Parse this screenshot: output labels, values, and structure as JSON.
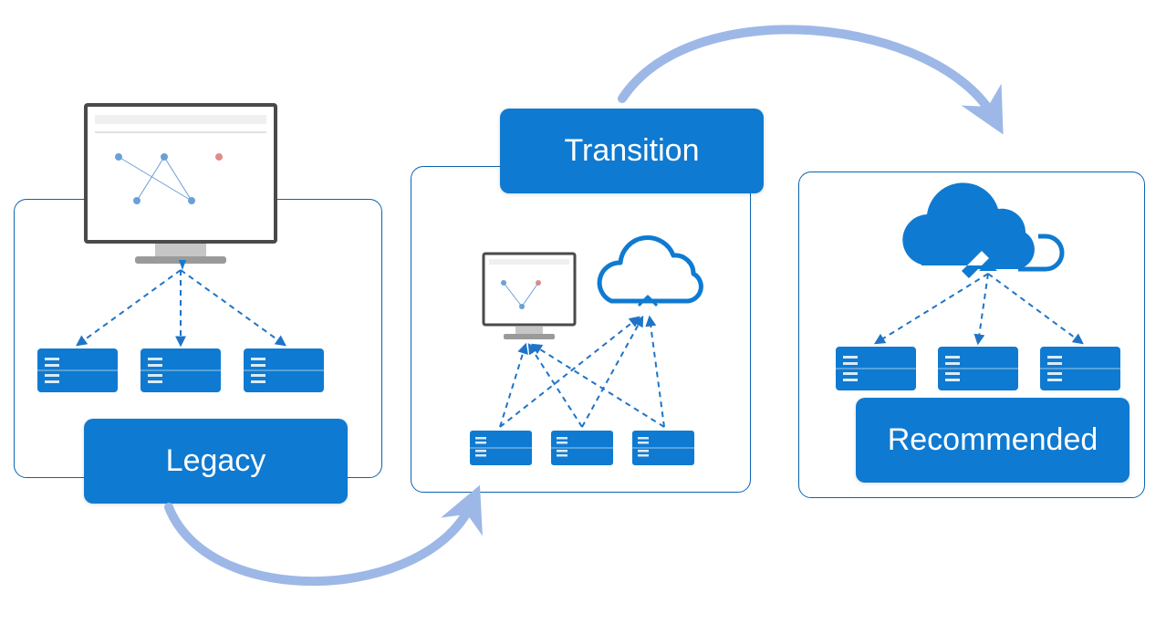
{
  "diagram": {
    "stages": {
      "legacy": {
        "label": "Legacy"
      },
      "transition": {
        "label": "Transition"
      },
      "recommended": {
        "label": "Recommended"
      }
    },
    "colors": {
      "accent": "#0f7ad1",
      "accentDark": "#0a63b0",
      "arrowSoft": "#9db8e6",
      "dash": "#1e74c7"
    }
  }
}
